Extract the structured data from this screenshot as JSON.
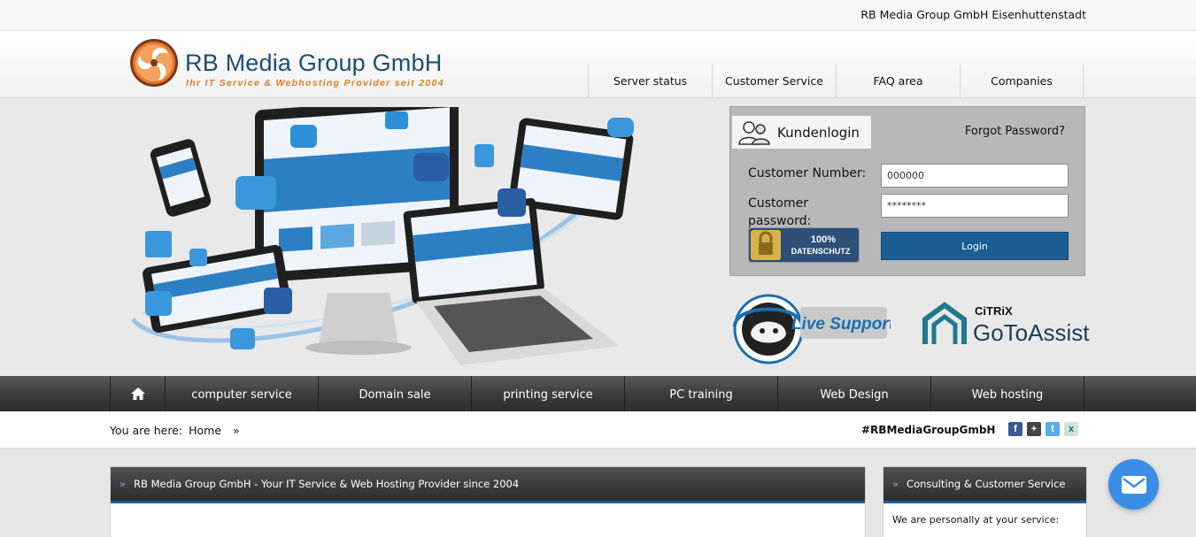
{
  "topbar": {
    "location": "RB Media Group GmbH Eisenhuttenstadt"
  },
  "logo": {
    "name": "RB Media Group GmbH",
    "tagline": "Ihr IT Service & Webhosting Provider seit 2004"
  },
  "top_nav": [
    {
      "label": "Server status"
    },
    {
      "label": "Customer Service"
    },
    {
      "label": "FAQ area"
    },
    {
      "label": "Companies"
    }
  ],
  "login": {
    "tab_label": "Kundenlogin",
    "forgot_label": "Forgot Password?",
    "number_label": "Customer Number:",
    "number_value": "000000",
    "password_label": "Customer password:",
    "password_value": "********",
    "button_label": "Login",
    "seal_line1": "100%",
    "seal_line2": "DATENSCHUTZ"
  },
  "badges": {
    "live_support": "Live Support",
    "citrix": "CiTRiX",
    "gotoassist": "GoToAssist"
  },
  "main_nav": [
    {
      "label": "computer service"
    },
    {
      "label": "Domain sale"
    },
    {
      "label": "printing service"
    },
    {
      "label": "PC training"
    },
    {
      "label": "Web Design"
    },
    {
      "label": "Web hosting"
    }
  ],
  "breadcrumb": {
    "prefix": "You are here:",
    "home": "Home",
    "separator": "»"
  },
  "hashtag": "#RBMediaGroupGmbH",
  "social": [
    {
      "icon": "facebook-icon",
      "glyph": "f",
      "color": "#3b5998"
    },
    {
      "icon": "google-plus-icon",
      "glyph": "+",
      "color": "#444444"
    },
    {
      "icon": "twitter-icon",
      "glyph": "t",
      "color": "#55acee"
    },
    {
      "icon": "xing-icon",
      "glyph": "x",
      "color": "#cfe3dc"
    }
  ],
  "panels": {
    "main_title": "RB Media Group GmbH - Your IT Service & Web Hosting Provider since 2004",
    "side_title": "Consulting & Customer Service",
    "side_text": "We are personally at your service:",
    "chevron": "»"
  },
  "colors": {
    "accent": "#1c5f9b",
    "login_button": "#1a5e94",
    "chat_button": "#3b8ee6",
    "logo_orange": "#e27a25",
    "logo_blue": "#1b4f73"
  }
}
